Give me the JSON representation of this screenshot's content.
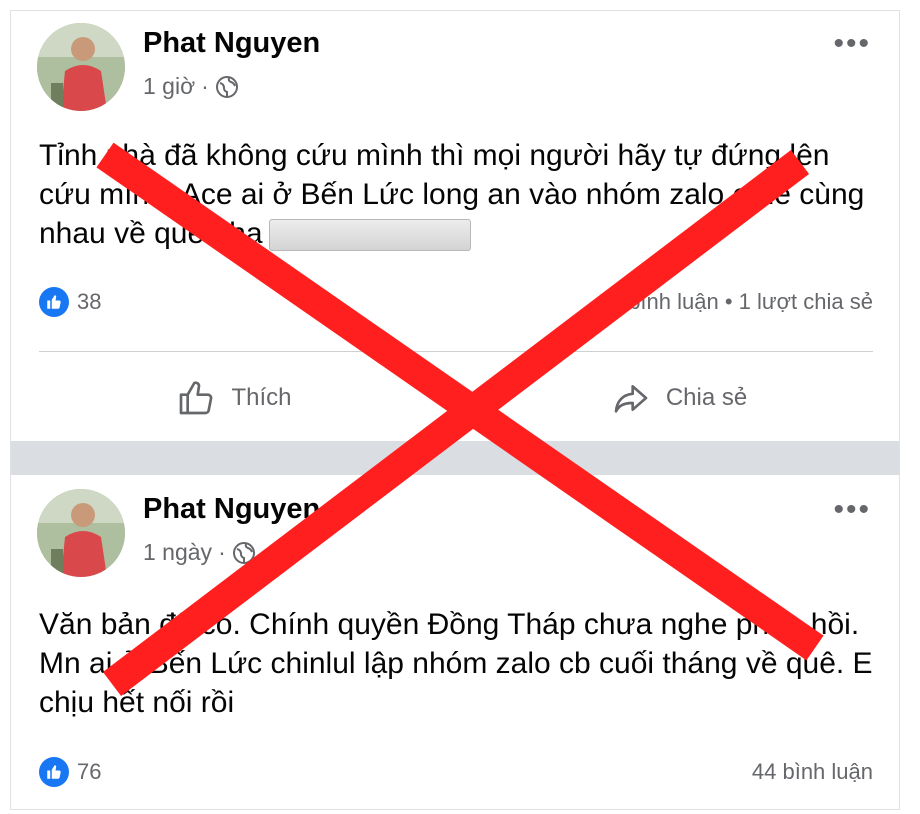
{
  "posts": [
    {
      "author": "Phat Nguyen",
      "time": "1 giờ",
      "text": "Tỉnh nhà đã không cứu mình thì mọi người hãy tự đứng lên cứu mình. Ace ai ở Bến Lức long an vào nhóm zalo e để cùng nhau về quê nha",
      "likes": "38",
      "comments": "29 bình luận",
      "shares": "1 lượt chia sẻ",
      "like_label": "Thích",
      "share_label": "Chia sẻ"
    },
    {
      "author": "Phat Nguyen",
      "time": "1 ngày",
      "text": "Văn bản đã có. Chính quyền Đồng Tháp chưa nghe phản hồi. Mn ai ở Bến Lức chinlul lập nhóm zalo cb cuối tháng về quê. E chịu hết nối rồi",
      "likes": "76",
      "comments": "44 bình luận"
    }
  ],
  "icons": {
    "globe": "globe-icon",
    "like_badge": "like-badge-icon",
    "thumbs_up": "thumbs-up-icon",
    "share": "share-arrow-icon",
    "more": "more-options-icon",
    "cross": "red-x-overlay"
  },
  "colors": {
    "facebook_blue": "#1877f2",
    "overlay_red": "#ff1f1f",
    "secondary_text": "#65676b"
  }
}
